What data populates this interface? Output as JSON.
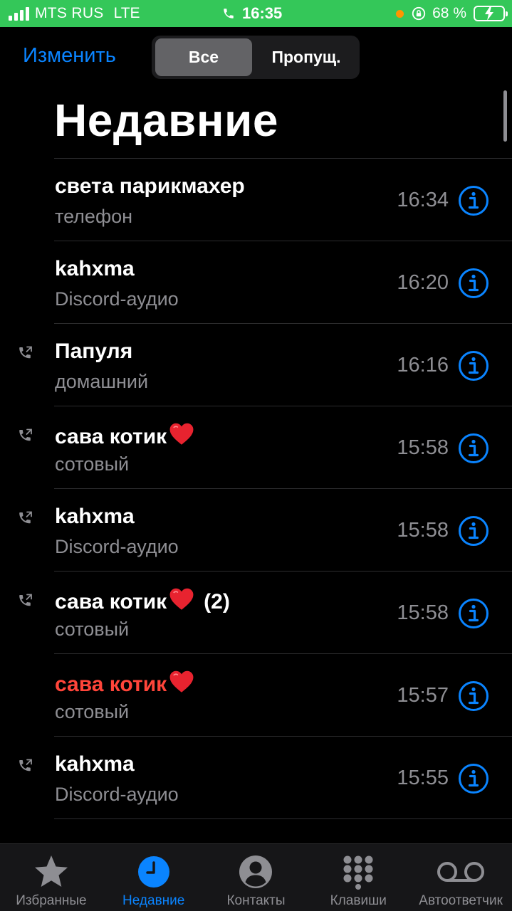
{
  "status_bar": {
    "carrier": "MTS RUS",
    "network": "LTE",
    "time": "16:35",
    "battery_percent": "68 %",
    "signal_bars": 4,
    "icons": [
      "signal-bars-icon",
      "phone-active-icon",
      "orange-dot-indicator",
      "rotation-lock-icon",
      "battery-charging-icon"
    ]
  },
  "nav": {
    "edit_label": "Изменить",
    "segments": {
      "all": "Все",
      "missed": "Пропущ."
    },
    "selected_segment": "all"
  },
  "page_title": "Недавние",
  "calls": [
    {
      "name": "света парикмахер",
      "type": "телефон",
      "time": "16:34",
      "outgoing": false,
      "missed": false,
      "heart": false,
      "count": ""
    },
    {
      "name": "kahxma",
      "type": "Discord-аудио",
      "time": "16:20",
      "outgoing": false,
      "missed": false,
      "heart": false,
      "count": ""
    },
    {
      "name": "Папуля",
      "type": "домашний",
      "time": "16:16",
      "outgoing": true,
      "missed": false,
      "heart": false,
      "count": ""
    },
    {
      "name": "сава котик",
      "type": "сотовый",
      "time": "15:58",
      "outgoing": true,
      "missed": false,
      "heart": true,
      "count": ""
    },
    {
      "name": "kahxma",
      "type": "Discord-аудио",
      "time": "15:58",
      "outgoing": true,
      "missed": false,
      "heart": false,
      "count": ""
    },
    {
      "name": "сава котик",
      "type": "сотовый",
      "time": "15:58",
      "outgoing": true,
      "missed": false,
      "heart": true,
      "count": "(2)"
    },
    {
      "name": "сава котик",
      "type": "сотовый",
      "time": "15:57",
      "outgoing": false,
      "missed": true,
      "heart": true,
      "count": ""
    },
    {
      "name": "kahxma",
      "type": "Discord-аудио",
      "time": "15:55",
      "outgoing": true,
      "missed": false,
      "heart": false,
      "count": ""
    }
  ],
  "tabs": [
    {
      "label": "Избранные",
      "icon": "star-icon",
      "active": false
    },
    {
      "label": "Недавние",
      "icon": "clock-icon",
      "active": true
    },
    {
      "label": "Контакты",
      "icon": "person-circle-icon",
      "active": false
    },
    {
      "label": "Клавиши",
      "icon": "keypad-icon",
      "active": false
    },
    {
      "label": "Автоответчик",
      "icon": "voicemail-icon",
      "active": false
    }
  ],
  "colors": {
    "status_bar": "#34c759",
    "accent": "#0a84ff",
    "missed": "#ff453a",
    "secondary_text": "#8e8e93",
    "background": "#000000",
    "heart": "#e8232f"
  }
}
